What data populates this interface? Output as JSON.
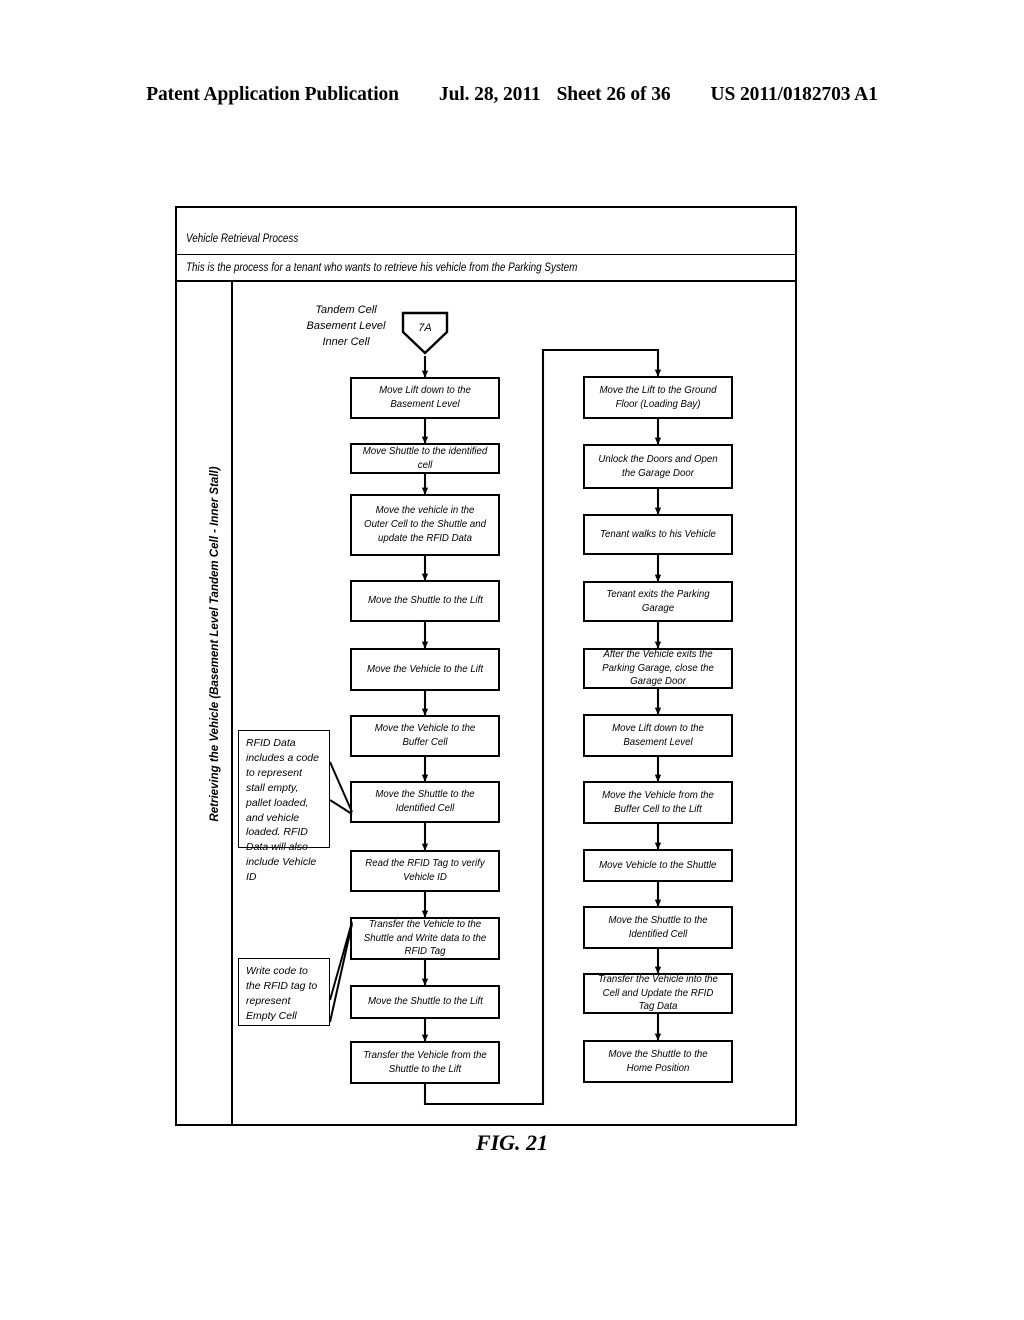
{
  "header": {
    "publication": "Patent Application Publication",
    "date": "Jul. 28, 2011",
    "sheet": "Sheet 26 of 36",
    "number": "US 2011/0182703 A1"
  },
  "figure": {
    "caption": "FIG. 21",
    "title": "Vehicle Retrieval Process",
    "subtitle": "This is the process for a tenant who wants to retrieve his vehicle from the Parking System",
    "lane_label": "Retrieving the Vehicle (Basement Level Tandem Cell - Inner Stall)"
  },
  "start": {
    "label": "Tandem Cell\nBasement Level\nInner Cell",
    "label_line1": "Tandem Cell",
    "label_line2": "Basement Level",
    "label_line3": "Inner Cell",
    "connector_id": "7A"
  },
  "left_column": [
    {
      "id": "L1",
      "text": "Move Lift down to the Basement Level"
    },
    {
      "id": "L2",
      "text": "Move Shuttle to the identified cell"
    },
    {
      "id": "L3",
      "text": "Move the vehicle in the Outer Cell to the Shuttle and update the RFID Data"
    },
    {
      "id": "L4",
      "text": "Move the Shuttle to the Lift"
    },
    {
      "id": "L5",
      "text": "Move the Vehicle to the Lift"
    },
    {
      "id": "L6",
      "text": "Move the Vehicle to the Buffer Cell"
    },
    {
      "id": "L7",
      "text": "Move the Shuttle to the Identified Cell"
    },
    {
      "id": "L8",
      "text": "Read the RFID Tag to verify Vehicle ID"
    },
    {
      "id": "L9",
      "text": "Transfer the Vehicle to the Shuttle and Write data to the RFID Tag"
    },
    {
      "id": "L10",
      "text": "Move the Shuttle to the Lift"
    },
    {
      "id": "L11",
      "text": "Transfer the Vehicle from the Shuttle to the Lift"
    }
  ],
  "right_column": [
    {
      "id": "R1",
      "text": "Move the Lift to the Ground Floor (Loading Bay)"
    },
    {
      "id": "R2",
      "text": "Unlock the Doors and Open the Garage Door"
    },
    {
      "id": "R3",
      "text": "Tenant walks to his Vehicle"
    },
    {
      "id": "R4",
      "text": "Tenant exits the Parking Garage"
    },
    {
      "id": "R5",
      "text": "After the Vehicle exits the Parking Garage, close the Garage Door"
    },
    {
      "id": "R6",
      "text": "Move Lift down to the Basement Level"
    },
    {
      "id": "R7",
      "text": "Move the Vehicle from the Buffer Cell to the Lift"
    },
    {
      "id": "R8",
      "text": "Move Vehicle to the Shuttle"
    },
    {
      "id": "R9",
      "text": "Move the Shuttle to the Identified Cell"
    },
    {
      "id": "R10",
      "text": "Transfer the Vehicle into the Cell and Update the RFID Tag Data"
    },
    {
      "id": "R11",
      "text": "Move the Shuttle to the Home Position"
    }
  ],
  "notes": [
    {
      "id": "N1",
      "text": "RFID Data includes a code to represent stall empty, pallet loaded, and vehicle loaded. RFID Data will also include Vehicle ID"
    },
    {
      "id": "N2",
      "text": "Write code to the RFID tag to represent Empty Cell"
    }
  ],
  "colors": {
    "line": "#000000",
    "background": "#ffffff"
  }
}
